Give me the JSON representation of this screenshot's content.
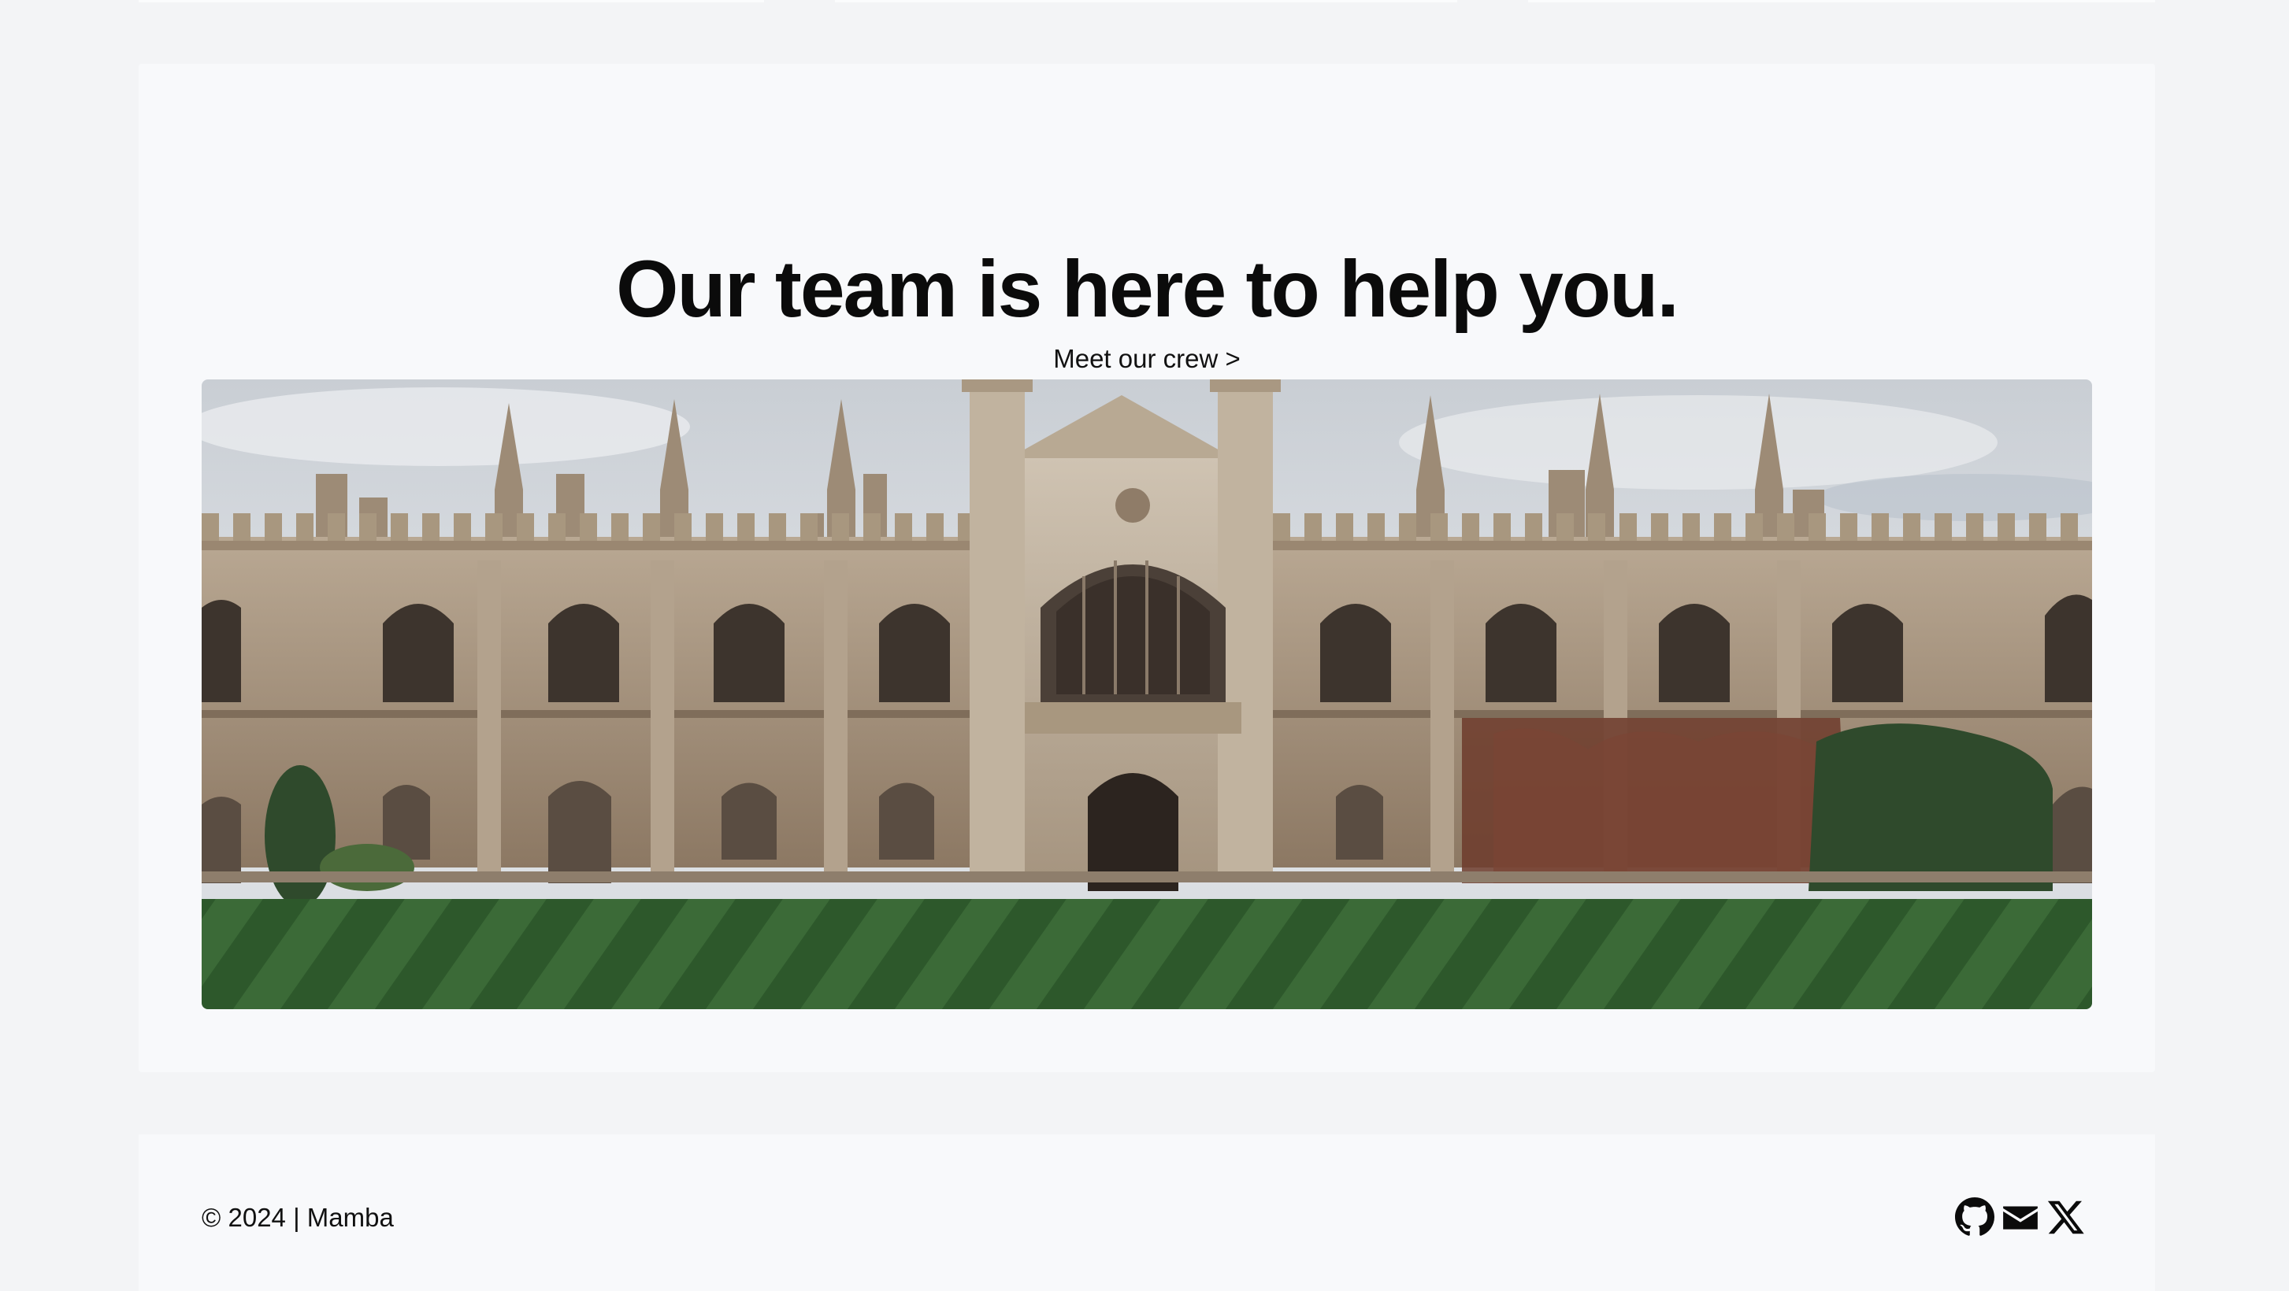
{
  "hero": {
    "title": "Our team is here to help you.",
    "crew_link": "Meet our crew >",
    "image_alt": "Historic college building with striped lawn"
  },
  "footer": {
    "copyright": "© 2024 | Mamba",
    "social": [
      {
        "icon": "github-icon"
      },
      {
        "icon": "mail-icon"
      },
      {
        "icon": "x-twitter-icon"
      }
    ]
  },
  "colors": {
    "page_background": "#f3f4f6",
    "card_background": "#f8f9fb",
    "text": "#0b0b0b",
    "lawn_dark": "#2f5a2f",
    "lawn_light": "#4f8447",
    "stone": "#a6917a",
    "sky": "#d9dee4"
  }
}
